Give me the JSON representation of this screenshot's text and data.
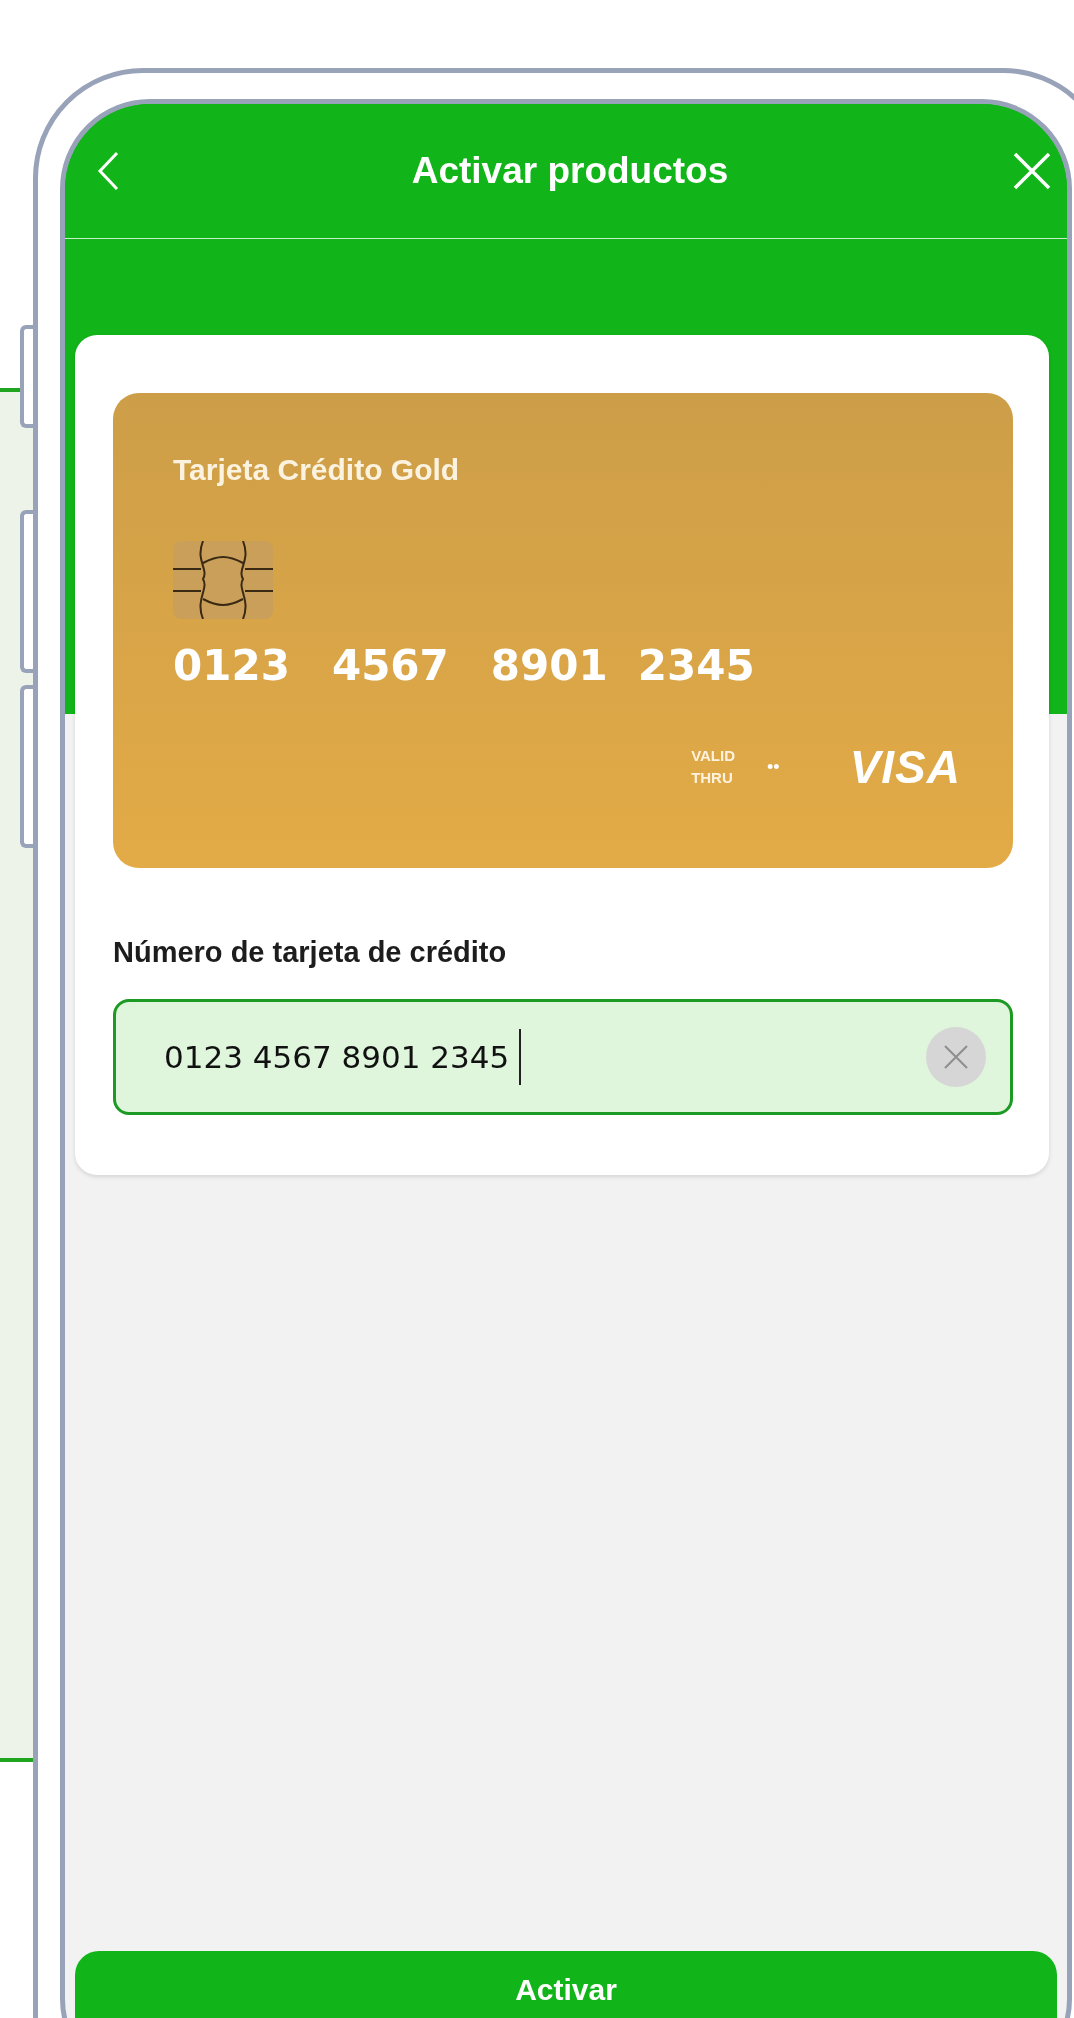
{
  "header": {
    "title": "Activar productos"
  },
  "card": {
    "title": "Tarjeta Crédito Gold",
    "number_groups": [
      "0123",
      "4567",
      "8901",
      "2345"
    ],
    "valid_label": [
      "VALID",
      "THRU"
    ],
    "expiry": "••",
    "brand": "VISA"
  },
  "field": {
    "label": "Número de tarjeta de crédito",
    "value": "0123 4567 8901 2345",
    "focused": true
  },
  "button": {
    "label": "Activar"
  }
}
